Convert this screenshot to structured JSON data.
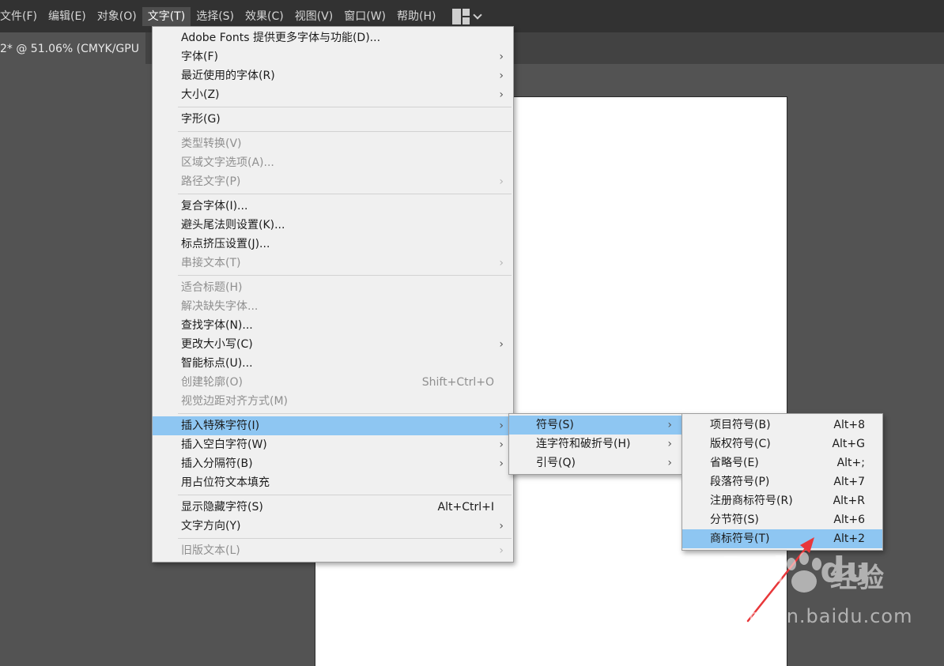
{
  "menubar": {
    "items": [
      {
        "label": "文件(F)",
        "active": false
      },
      {
        "label": "编辑(E)",
        "active": false
      },
      {
        "label": "对象(O)",
        "active": false
      },
      {
        "label": "文字(T)",
        "active": true
      },
      {
        "label": "选择(S)",
        "active": false
      },
      {
        "label": "效果(C)",
        "active": false
      },
      {
        "label": "视图(V)",
        "active": false
      },
      {
        "label": "窗口(W)",
        "active": false
      },
      {
        "label": "帮助(H)",
        "active": false
      }
    ],
    "workspace_icon": "layout-grid-icon",
    "workspace_chevron": "chevron-down-icon"
  },
  "document_tab": {
    "label": "2* @ 51.06% (CMYK/GPU"
  },
  "type_menu": {
    "groups": [
      [
        {
          "label": "Adobe Fonts 提供更多字体与功能(D)...",
          "shortcut": "",
          "submenu": false,
          "disabled": false
        },
        {
          "label": "字体(F)",
          "shortcut": "",
          "submenu": true,
          "disabled": false
        },
        {
          "label": "最近使用的字体(R)",
          "shortcut": "",
          "submenu": true,
          "disabled": false
        },
        {
          "label": "大小(Z)",
          "shortcut": "",
          "submenu": true,
          "disabled": false
        }
      ],
      [
        {
          "label": "字形(G)",
          "shortcut": "",
          "submenu": false,
          "disabled": false
        }
      ],
      [
        {
          "label": "类型转换(V)",
          "shortcut": "",
          "submenu": false,
          "disabled": true
        },
        {
          "label": "区域文字选项(A)...",
          "shortcut": "",
          "submenu": false,
          "disabled": true
        },
        {
          "label": "路径文字(P)",
          "shortcut": "",
          "submenu": true,
          "disabled": true
        }
      ],
      [
        {
          "label": "复合字体(I)...",
          "shortcut": "",
          "submenu": false,
          "disabled": false
        },
        {
          "label": "避头尾法则设置(K)...",
          "shortcut": "",
          "submenu": false,
          "disabled": false
        },
        {
          "label": "标点挤压设置(J)...",
          "shortcut": "",
          "submenu": false,
          "disabled": false
        },
        {
          "label": "串接文本(T)",
          "shortcut": "",
          "submenu": true,
          "disabled": true
        }
      ],
      [
        {
          "label": "适合标题(H)",
          "shortcut": "",
          "submenu": false,
          "disabled": true
        },
        {
          "label": "解决缺失字体...",
          "shortcut": "",
          "submenu": false,
          "disabled": true
        },
        {
          "label": "查找字体(N)...",
          "shortcut": "",
          "submenu": false,
          "disabled": false
        },
        {
          "label": "更改大小写(C)",
          "shortcut": "",
          "submenu": true,
          "disabled": false
        },
        {
          "label": "智能标点(U)...",
          "shortcut": "",
          "submenu": false,
          "disabled": false
        },
        {
          "label": "创建轮廓(O)",
          "shortcut": "Shift+Ctrl+O",
          "submenu": false,
          "disabled": true
        },
        {
          "label": "视觉边距对齐方式(M)",
          "shortcut": "",
          "submenu": false,
          "disabled": true
        }
      ],
      [
        {
          "label": "插入特殊字符(I)",
          "shortcut": "",
          "submenu": true,
          "disabled": false,
          "highlighted": true
        },
        {
          "label": "插入空白字符(W)",
          "shortcut": "",
          "submenu": true,
          "disabled": false
        },
        {
          "label": "插入分隔符(B)",
          "shortcut": "",
          "submenu": true,
          "disabled": false
        },
        {
          "label": "用占位符文本填充",
          "shortcut": "",
          "submenu": false,
          "disabled": false
        }
      ],
      [
        {
          "label": "显示隐藏字符(S)",
          "shortcut": "Alt+Ctrl+I",
          "submenu": false,
          "disabled": false
        },
        {
          "label": "文字方向(Y)",
          "shortcut": "",
          "submenu": true,
          "disabled": false
        }
      ],
      [
        {
          "label": "旧版文本(L)",
          "shortcut": "",
          "submenu": true,
          "disabled": true
        }
      ]
    ]
  },
  "special_char_submenu": {
    "items": [
      {
        "label": "符号(S)",
        "submenu": true,
        "highlighted": true
      },
      {
        "label": "连字符和破折号(H)",
        "submenu": true,
        "highlighted": false
      },
      {
        "label": "引号(Q)",
        "submenu": true,
        "highlighted": false
      }
    ]
  },
  "symbol_submenu": {
    "items": [
      {
        "label": "项目符号(B)",
        "shortcut": "Alt+8",
        "highlighted": false
      },
      {
        "label": "版权符号(C)",
        "shortcut": "Alt+G",
        "highlighted": false
      },
      {
        "label": "省略号(E)",
        "shortcut": "Alt+;",
        "highlighted": false
      },
      {
        "label": "段落符号(P)",
        "shortcut": "Alt+7",
        "highlighted": false
      },
      {
        "label": "注册商标符号(R)",
        "shortcut": "Alt+R",
        "highlighted": false
      },
      {
        "label": "分节符(S)",
        "shortcut": "Alt+6",
        "highlighted": false
      },
      {
        "label": "商标符号(T)",
        "shortcut": "Alt+2",
        "highlighted": true
      }
    ]
  },
  "submenu_arrow_glyph": "›",
  "watermark": {
    "logo_text": "Bai",
    "logo_text2": "du",
    "cn_text": "经验",
    "url": "jingyan.baidu.com"
  },
  "colors": {
    "menubar_bg": "#323232",
    "canvas_bg": "#535353",
    "menu_bg": "#f0f0f0",
    "highlight": "#8ec6f2",
    "annotation_arrow": "#e8373a"
  }
}
